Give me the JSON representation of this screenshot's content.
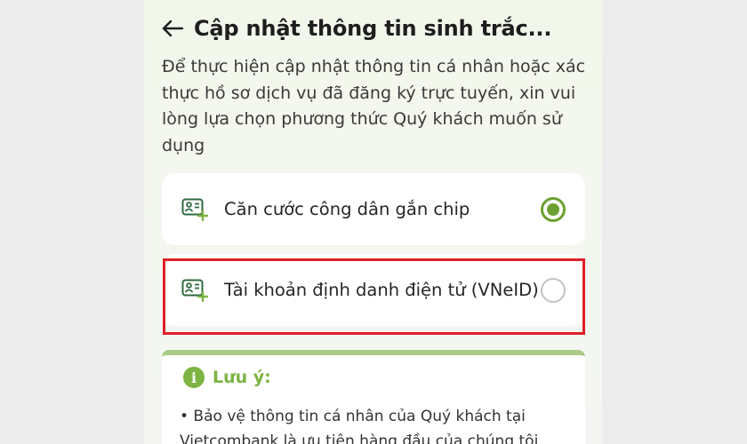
{
  "header": {
    "title": "Cập nhật thông tin sinh trắc...",
    "back_icon": "arrow-left-icon"
  },
  "intro": {
    "text": "Để thực hiện cập nhật thông tin cá nhân hoặc xác thực hồ sơ dịch vụ đã đăng ký trực tuyến, xin vui lòng lựa chọn phương thức Quý khách muốn sử dụng"
  },
  "options": [
    {
      "label": "Căn cước công dân gắn chip",
      "icon": "id-card-add-icon",
      "selected": true
    },
    {
      "label": "Tài khoản định danh điện tử (VNeID)",
      "icon": "id-card-add-icon",
      "selected": false
    }
  ],
  "note": {
    "title": "Lưu ý:",
    "icon": "info-icon",
    "body": "• Bảo vệ thông tin cá nhân của Quý khách tại Vietcombank là ưu tiên hàng đầu của chúng tôi."
  },
  "colors": {
    "accent": "#7cb342",
    "radio_selected": "#6ca030",
    "highlight_border": "#de1f26",
    "note_top_border": "#a9cc84"
  }
}
